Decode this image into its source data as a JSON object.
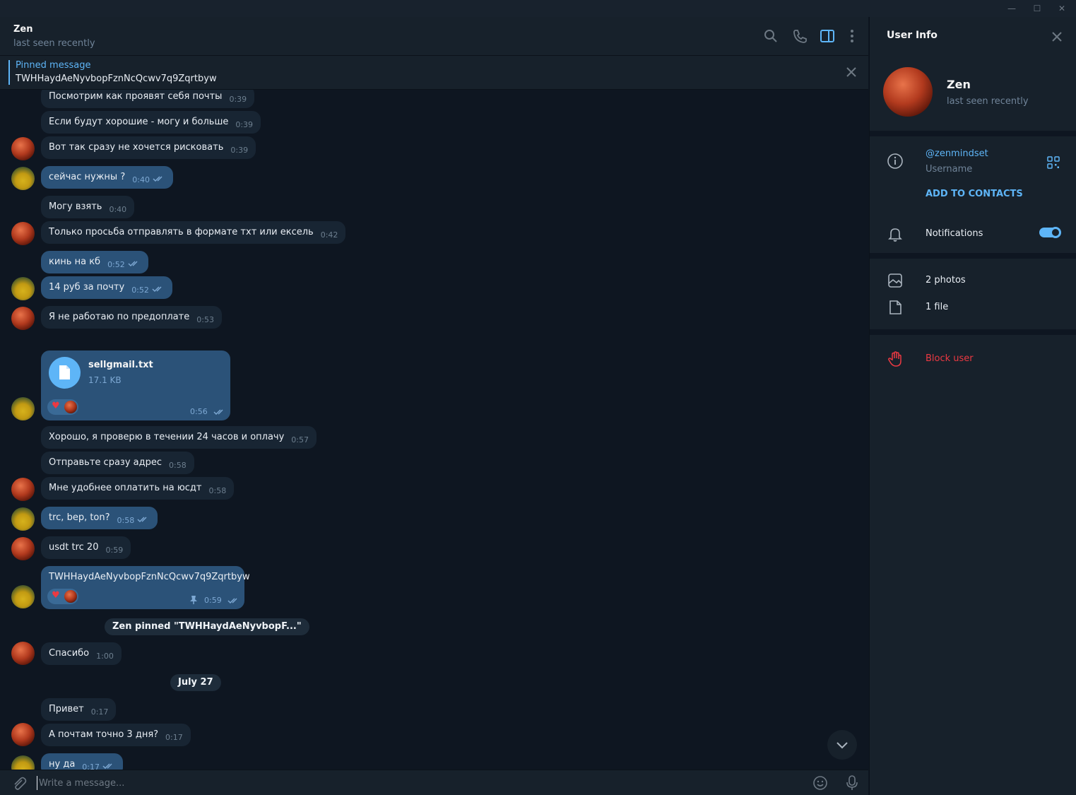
{
  "window": {
    "min": "—",
    "max": "☐",
    "close": "✕"
  },
  "chat": {
    "name": "Zen",
    "status": "last seen recently",
    "pinned_label": "Pinned message",
    "pinned_text": "TWHHaydAeNyvbopFznNcQcwv7q9Zqrtbyw"
  },
  "messages": [
    {
      "text": "Посмотрим как проявят себя почты",
      "time": "0:39"
    },
    {
      "text": "Если будут хорошие - могу и больше",
      "time": "0:39"
    },
    {
      "text": "Вот так сразу не хочется рисковать",
      "time": "0:39"
    },
    {
      "text": "сейчас нужны ?",
      "time": "0:40"
    },
    {
      "text": "Могу взять",
      "time": "0:40"
    },
    {
      "text": "Только просьба отправлять в формате тхт или ексель",
      "time": "0:42"
    },
    {
      "text": "кинь на кб",
      "time": "0:52"
    },
    {
      "text": "14  руб за  почту",
      "time": "0:52"
    },
    {
      "text": "Я не работаю по предоплате",
      "time": "0:53"
    },
    {
      "text": "Хорошо, я проверю в течении 24 часов и оплачу",
      "time": "0:57"
    },
    {
      "text": "Отправьте сразу адрес",
      "time": "0:58"
    },
    {
      "text": "Мне удобнее оплатить на юсдт",
      "time": "0:58"
    },
    {
      "text": "trc, bep, ton?",
      "time": "0:58"
    },
    {
      "text": "usdt trc 20",
      "time": "0:59"
    },
    {
      "text": "TWHHaydAeNyvbopFznNcQcwv7q9Zqrtbyw",
      "time": "0:59"
    },
    {
      "text": "Спасибо",
      "time": "1:00"
    },
    {
      "text": "Привет",
      "time": "0:17"
    },
    {
      "text": "А почтам точно 3 дня?",
      "time": "0:17"
    },
    {
      "text": "ну да",
      "time": "0:17"
    }
  ],
  "file": {
    "name": "sellgmail.txt",
    "size": "17.1 KB",
    "time": "0:56"
  },
  "service_pinned": "Zen pinned \"TWHHaydAeNyvbopF...\"",
  "date_label": "July 27",
  "composer": {
    "placeholder": "Write a message..."
  },
  "info": {
    "title": "User Info",
    "name": "Zen",
    "status": "last seen recently",
    "username": "@zenmindset",
    "username_label": "Username",
    "add_contacts": "ADD TO CONTACTS",
    "notifications": "Notifications",
    "notifications_on": true,
    "photos": "2 photos",
    "files": "1 file",
    "block": "Block user"
  },
  "colors": {
    "accent": "#5eb5f7",
    "danger": "#ec3942",
    "out_bubble": "#2b5278",
    "in_bubble": "#182533"
  }
}
